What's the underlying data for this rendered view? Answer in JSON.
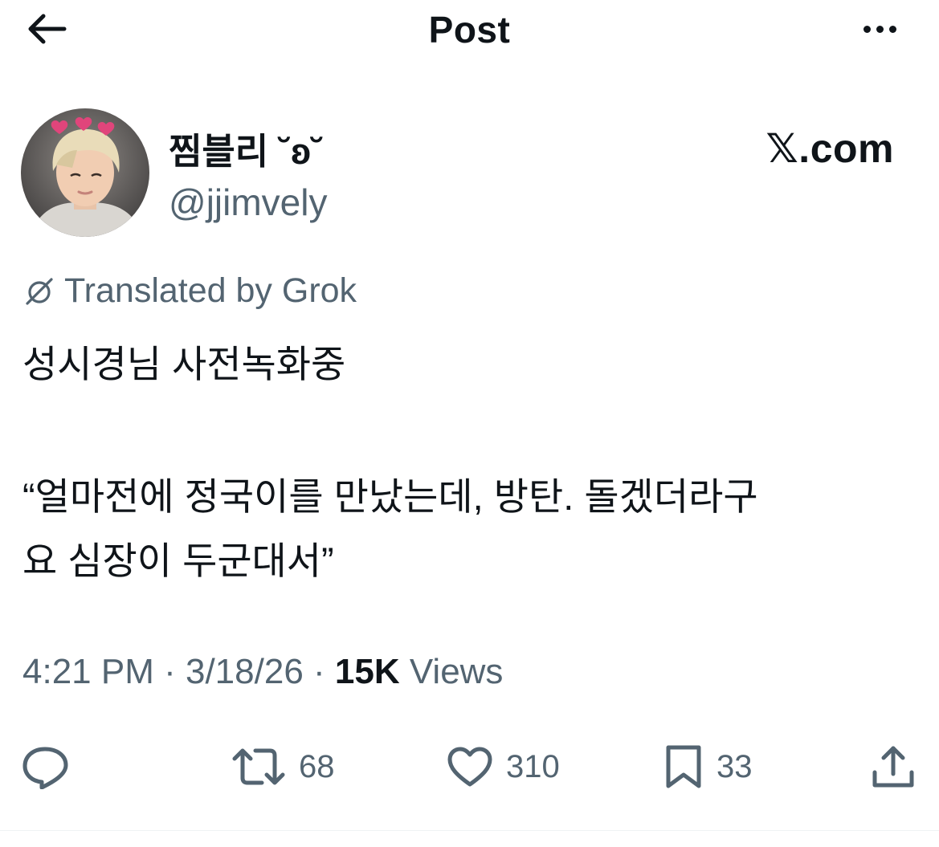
{
  "header": {
    "title": "Post",
    "back_icon": "arrow-left-icon",
    "more_icon": "more-horizontal-icon"
  },
  "author": {
    "display_name": "찜블리 ˘ʚ˘",
    "handle": "@jjimvely",
    "avatar_icon": "avatar-photo"
  },
  "source": {
    "logo_text": "𝕏.com"
  },
  "translation": {
    "label": "Translated by Grok",
    "icon": "grok-icon"
  },
  "post": {
    "line_1": "성시경님 사전녹화중",
    "line_2": "“얼마전에 정국이를 만났는데, 방탄. 돌겠더라구",
    "line_3": "요 심장이 두군대서”"
  },
  "meta": {
    "time": "4:21 PM",
    "separator": " · ",
    "date": "3/18/26",
    "views_count": "15K",
    "views_label": "Views"
  },
  "actions": {
    "reply": {
      "icon": "reply-icon",
      "count": ""
    },
    "repost": {
      "icon": "repost-icon",
      "count": "68"
    },
    "like": {
      "icon": "heart-icon",
      "count": "310"
    },
    "bookmark": {
      "icon": "bookmark-icon",
      "count": "33"
    },
    "share": {
      "icon": "share-icon",
      "count": ""
    }
  },
  "colors": {
    "text_primary": "#0f1419",
    "text_secondary": "#536471",
    "divider": "#eff3f4",
    "heart_accent": "#e0457b"
  }
}
